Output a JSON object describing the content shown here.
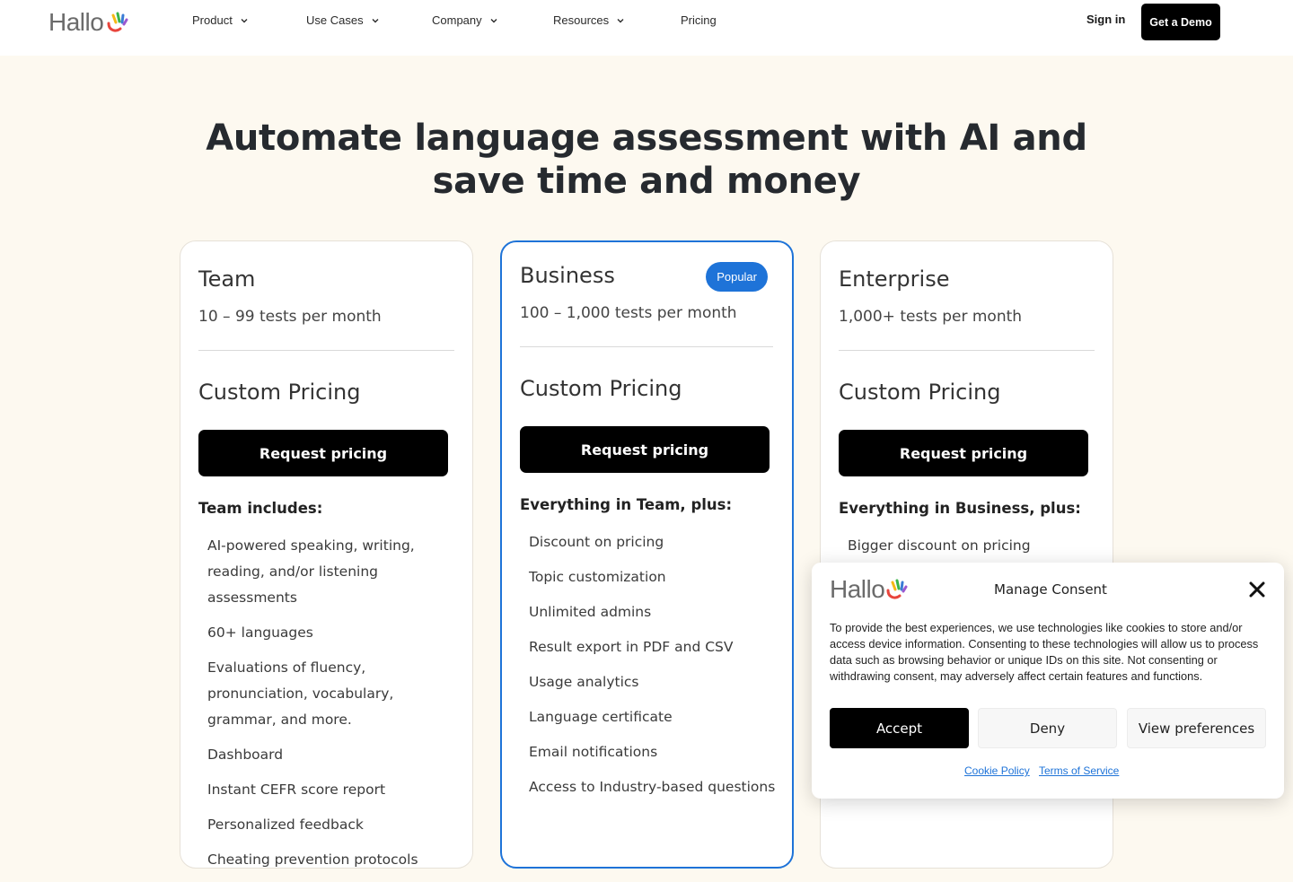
{
  "brand": {
    "name": "Hallo"
  },
  "nav": {
    "items": [
      {
        "label": "Product",
        "has_menu": true
      },
      {
        "label": "Use Cases",
        "has_menu": true
      },
      {
        "label": "Company",
        "has_menu": true
      },
      {
        "label": "Resources",
        "has_menu": true
      },
      {
        "label": "Pricing",
        "has_menu": false
      }
    ],
    "sign_in": "Sign in",
    "demo": "Get a Demo"
  },
  "hero": {
    "title": "Automate language assessment with AI and save time and money"
  },
  "plans": [
    {
      "name": "Team",
      "sub": "10 – 99 tests per month",
      "price": "Custom Pricing",
      "cta": "Request pricing",
      "includes": "Team includes:",
      "features": [
        "AI-powered speaking, writing, reading, and/or listening assessments",
        "60+ languages",
        "Evaluations of fluency, pronunciation, vocabulary, grammar, and more.",
        "Dashboard",
        "Instant CEFR score report",
        "Personalized feedback",
        "Cheating prevention protocols"
      ]
    },
    {
      "name": "Business",
      "badge": "Popular",
      "sub": "100 – 1,000 tests per month",
      "price": "Custom Pricing",
      "cta": "Request pricing",
      "includes": "Everything in Team, plus:",
      "features": [
        "Discount on pricing",
        "Topic customization",
        "Unlimited admins",
        "Result export in PDF and CSV",
        "Usage analytics",
        "Language certificate",
        "Email notifications",
        "Access to Industry-based questions"
      ]
    },
    {
      "name": "Enterprise",
      "sub": "1,000+ tests per month",
      "price": "Custom Pricing",
      "cta": "Request pricing",
      "includes": "Everything in Business, plus:",
      "features": [
        "Bigger discount on pricing"
      ]
    }
  ],
  "consent": {
    "title": "Manage Consent",
    "text": "To provide the best experiences, we use technologies like cookies to store and/or access device information. Consenting to these technologies will allow us to process data such as browsing behavior or unique IDs on this site. Not consenting or withdrawing consent, may adversely affect certain features and functions.",
    "accept": "Accept",
    "deny": "Deny",
    "preferences": "View preferences",
    "links": [
      "Cookie Policy",
      "Terms of Service"
    ]
  },
  "icons": {
    "logo_wave": "hand-wave-icon",
    "dropdown": "chevron-down-icon",
    "close": "close-icon"
  },
  "colors": {
    "accent": "#1e73d8",
    "background": "#fdf9f0",
    "button": "#000000",
    "logo_red": "#e8453c",
    "logo_yellow": "#f5b916",
    "logo_green": "#3cb54a",
    "logo_blue": "#3a7bd5"
  }
}
